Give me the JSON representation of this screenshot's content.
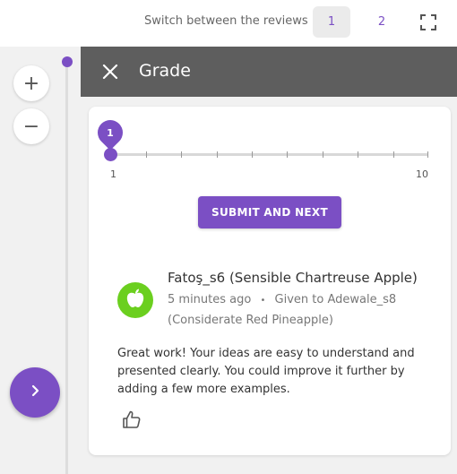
{
  "topbar": {
    "switch_label": "Switch between the reviews",
    "reviews": [
      "1",
      "2"
    ],
    "active_review": "1",
    "fullscreen_icon": "fullscreen-icon"
  },
  "leftpanel": {
    "zoom_in": "+",
    "zoom_out": "−",
    "next_icon": "chevron-right-icon"
  },
  "grade": {
    "title": "Grade",
    "close_icon": "close-icon",
    "slider": {
      "min": "1",
      "max": "10",
      "value": "1"
    },
    "submit_label": "SUBMIT AND NEXT"
  },
  "review": {
    "reviewer": "Fatoş_s6 (Sensible Chartreuse Apple)",
    "time": "5 minutes ago",
    "separator": "•",
    "given_to": "Given to Adewale_s8",
    "given_to_team": "(Considerate Red Pineapple)",
    "comment": "Great work! Your ideas are easy to understand and presented clearly. You could improve it further by adding a few more examples.",
    "avatar_icon": "apple-icon",
    "like_icon": "thumbs-up-icon"
  },
  "colors": {
    "accent": "#7b4fc4",
    "avatar": "#6bcf1f",
    "grade_bar": "#5e5e5e"
  }
}
